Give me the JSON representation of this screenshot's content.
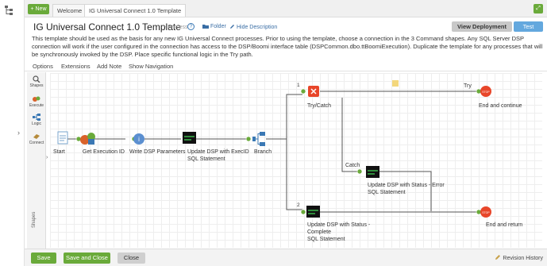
{
  "tabs": {
    "new_label": "+ New",
    "welcome_label": "Welcome",
    "active_label": "IG Universal Connect 1.0 Template"
  },
  "header": {
    "title": "IG Universal Connect 1.0 Template",
    "process_type": "- Process",
    "help_glyph": "?",
    "folder_label": "Folder",
    "hide_description_label": "Hide Description",
    "view_deployment_label": "View Deployment",
    "test_label": "Test",
    "description": "This template should be used as the basis for any new IG Universal Connect processes. Prior to using the template, choose a connection in the 3 Command shapes. Any SQL Server DSP connection will work if the user configured in the connection has access to the DSP/Boomi interface table (DSPCommon.dbo.ttBoomiExecution). Duplicate the template for any processes that will be synchronously invoked by the DSP. Place specific functional logic in the Try path."
  },
  "menu": [
    "Options",
    "Extensions",
    "Add Note",
    "Show Navigation"
  ],
  "palette": {
    "items": [
      "Shapes",
      "Execute",
      "Logic",
      "Connect"
    ],
    "vertical_label": "Shapes"
  },
  "shapes": {
    "start": "Start",
    "get_execution_id": "Get Execution ID",
    "write_dsp_parameters": "Write DSP Parameters",
    "update_dsp_execid_1": "Update DSP with ExecID",
    "update_dsp_execid_2": "SQL Statement",
    "branch": "Branch",
    "try_catch": "Try/Catch",
    "end_continue": "End and continue",
    "update_error_1": "Update DSP with Status - Error",
    "update_error_2": "SQL Statement",
    "update_complete_1": "Update DSP with Status -",
    "update_complete_2": "Complete",
    "update_complete_3": "SQL Statement",
    "end_return": "End and return",
    "path_1": "1",
    "path_2": "2",
    "path_try": "Try",
    "path_catch": "Catch",
    "stop_text": "STOP"
  },
  "footer": {
    "save_label": "Save",
    "save_close_label": "Save and Close",
    "close_label": "Close",
    "revision_label": "Revision History"
  },
  "colors": {
    "accent_green": "#6aaa3a",
    "test_blue": "#63a8de",
    "link_blue": "#3a6ea5",
    "stop_red": "#e8462a"
  }
}
